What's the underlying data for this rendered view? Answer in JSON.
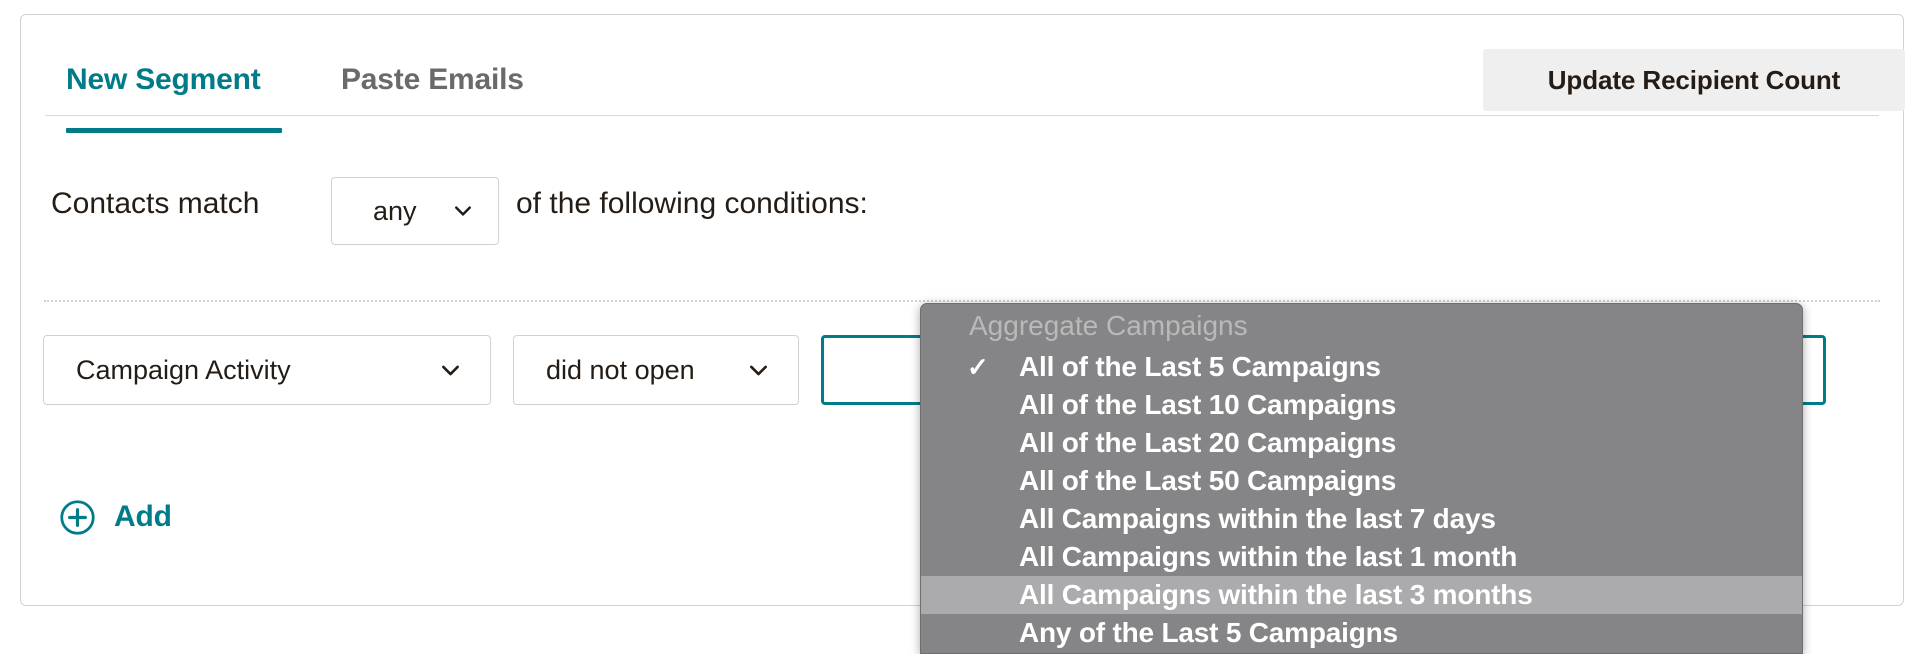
{
  "card": {
    "tabs": [
      {
        "label": "New Segment",
        "active": true
      },
      {
        "label": "Paste Emails",
        "active": false
      }
    ],
    "update_button_label": "Update Recipient Count"
  },
  "match_row": {
    "prefix_label": "Contacts match",
    "operator_value": "any",
    "suffix_label": "of the following conditions:"
  },
  "condition": {
    "field_value": "Campaign Activity",
    "operator_value": "did not open",
    "value_value": ""
  },
  "add": {
    "label": "Add",
    "icon": "circle-plus-icon"
  },
  "dropdown": {
    "group_label": "Aggregate Campaigns",
    "selected": "All of the Last 5 Campaigns",
    "highlighted": "All Campaigns within the last 3 months",
    "options": [
      {
        "label": "All of the Last 5 Campaigns",
        "checked": true,
        "highlighted": false
      },
      {
        "label": "All of the Last 10 Campaigns",
        "checked": false,
        "highlighted": false
      },
      {
        "label": "All of the Last 20 Campaigns",
        "checked": false,
        "highlighted": false
      },
      {
        "label": "All of the Last 50 Campaigns",
        "checked": false,
        "highlighted": false
      },
      {
        "label": "All Campaigns within the last 7 days",
        "checked": false,
        "highlighted": false
      },
      {
        "label": "All Campaigns within the last 1 month",
        "checked": false,
        "highlighted": false
      },
      {
        "label": "All Campaigns within the last 3 months",
        "checked": false,
        "highlighted": true
      },
      {
        "label": "Any of the Last 5 Campaigns",
        "checked": false,
        "highlighted": false
      }
    ],
    "checkmark_glyph": "✓"
  },
  "colors": {
    "accent_teal": "#007c89",
    "text_dark": "#241c15",
    "tab_inactive": "#6a6a6a",
    "button_bg": "#efeff0",
    "border": "#cfd2d4",
    "menu_bg": "#858587",
    "menu_highlight": "#ababad",
    "menu_group_label": "#b9b9ba"
  }
}
